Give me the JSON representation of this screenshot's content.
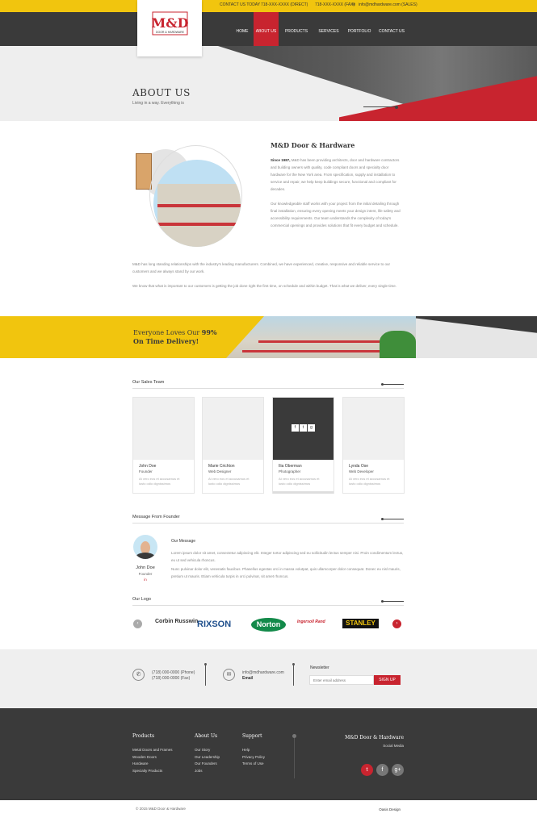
{
  "topbar": {
    "contact_label": "CONTACT US TODAY",
    "phone1": "718-XXX-XXXX (DIRECT)",
    "phone2": "718-XXX-XXXX (FAX)",
    "email": "info@mdhardware.com (SALES)"
  },
  "brand": {
    "logo_text": "M&D",
    "logo_sub": "DOOR & HARDWARE"
  },
  "nav": [
    {
      "label": "HOME"
    },
    {
      "label": "ABOUT US",
      "active": true
    },
    {
      "label": "PRODUCTS"
    },
    {
      "label": "SERVICES"
    },
    {
      "label": "PORTFOLIO"
    },
    {
      "label": "CONTACT US"
    }
  ],
  "hero": {
    "title": "ABOUT US",
    "subtitle": "Living in a way. Everything is"
  },
  "about": {
    "title": "M&D Door & Hardware",
    "p1_lead": "Since 1987,",
    "p1": " M&D has been providing architects, door and hardware contractors and building owners with quality, code compliant doors and specialty door hardware for the New York area. From specification, supply and installation to service and repair, we help keep buildings secure, functional and compliant for decades.",
    "p2": "Our knowledgeable staff works with your project from the initial detailing through final installation, ensuring every opening meets your design intent, life safety and accessibility requirements. Our team understands the complexity of today's commercial openings and provides solutions that fit every budget and schedule.",
    "p3": "M&D has long standing relationships with the industry's leading manufacturers. Combined, we have experienced, creative, responsive and reliable service to our customers and we always stand by our work.",
    "p4": "We know that what is important to our customers is getting the job done right the first time, on schedule and within budget. That is what we deliver, every single time."
  },
  "banner": {
    "line1": "Everyone Loves Our",
    "percent": "99%",
    "line2": "On Time Delivery!"
  },
  "team": {
    "heading": "Our Sales Team",
    "members": [
      {
        "name": "John Doe",
        "role": "Founder",
        "desc": "At vero eos et accusamus et iusto odio dignissimos"
      },
      {
        "name": "Marie Crichton",
        "role": "Web Designer",
        "desc": "At vero eos et accusamus et iusto odio dignissimos"
      },
      {
        "name": "Ilia Oberman",
        "role": "Photographer",
        "desc": "At vero eos et accusamus et iusto odio dignissimos"
      },
      {
        "name": "Lynda Ose",
        "role": "Web Developer",
        "desc": "At vero eos et accusamus et iusto odio dignissimos"
      }
    ],
    "social": [
      "f",
      "t",
      "g"
    ]
  },
  "founder": {
    "heading": "Message From Founder",
    "name": "John Doe",
    "role": "Founder",
    "msg_title": "Our Message",
    "msg1": "Lorem ipsum dolor sit amet, consectetur adipiscing elit. Integer tortor adipiscing sed eu sollicitudin lectus semper nisi. Proin condimentum lectus, eu ut sed vehicula rhoncus.",
    "msg2": "Nunc pulvinar dolor elit, venenatis faucibus. Phasellus egestas orci in massa volutpat, quis ullamcorper dolor consequat. Donec eu nisl mauris, pretium ut mauris. Etiam vehicula turpis in orci pulvinar, sit amet rhoncus."
  },
  "logos": {
    "heading": "Our Logo",
    "items": [
      "Corbin Russwin",
      "RIXSON",
      "Norton",
      "Ingersoll Rand",
      "STANLEY"
    ]
  },
  "contact": {
    "phone1": "(718) 000-0000 (Phone)",
    "phone2": "(718) 000-0000 (Fax)",
    "email": "info@mdhardware.com",
    "email_label": "Email",
    "newsletter_label": "Newsletter",
    "newsletter_placeholder": "Enter email address",
    "signup": "SIGN UP"
  },
  "footer": {
    "products": {
      "title": "Products",
      "items": [
        "Metal Doors and Frames",
        "Wooden Doors",
        "Hardware",
        "Specialty Products"
      ]
    },
    "about": {
      "title": "About Us",
      "items": [
        "Our Story",
        "Our Leadership",
        "Our Founders",
        "Jobs"
      ]
    },
    "support": {
      "title": "Support",
      "items": [
        "Help",
        "Privacy Policy",
        "Terms of Use"
      ]
    },
    "brand": "M&D Door & Hardware",
    "social_label": "Social Media",
    "social": [
      "t",
      "f",
      "g+"
    ]
  },
  "bottom": {
    "copyright": "© 2015 M&D Door & Hardware",
    "credit": "Oasis Design"
  },
  "colors": {
    "accent": "#c8242f",
    "yellow": "#f1c50e",
    "dark": "#3a3a3a"
  }
}
